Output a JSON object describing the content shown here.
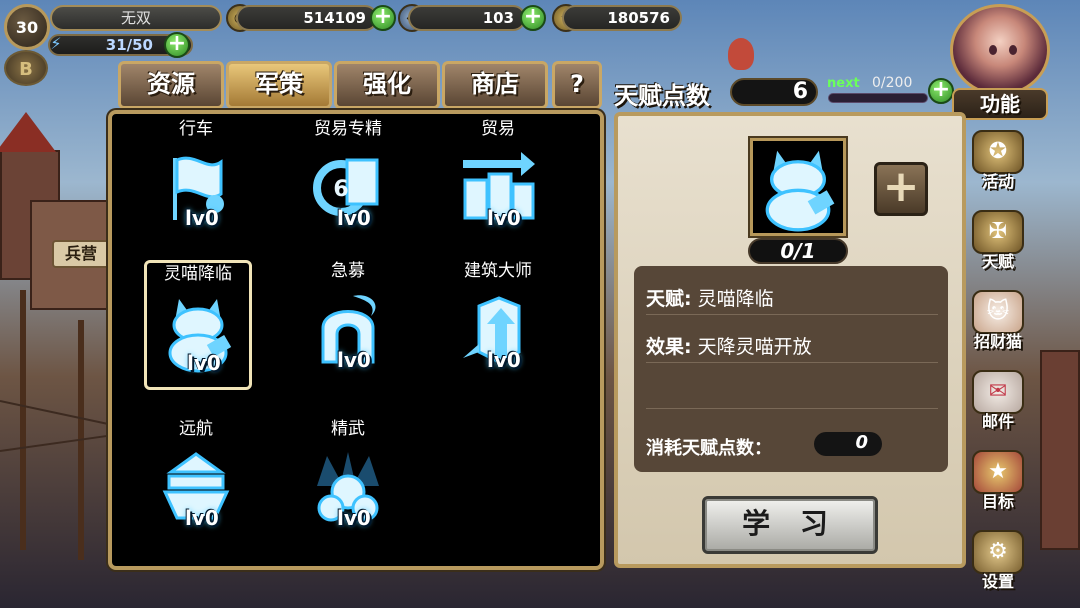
{
  "player": {
    "level": "30",
    "name": "无双",
    "gold": "514109",
    "gems": "103",
    "wheat": "180576",
    "energy": "31/50",
    "coin_letter": "B"
  },
  "tabs": [
    {
      "label": "资源",
      "active": false
    },
    {
      "label": "军策",
      "active": true
    },
    {
      "label": "强化",
      "active": false
    },
    {
      "label": "商店",
      "active": false
    },
    {
      "label": "?",
      "active": false
    }
  ],
  "talent_points": {
    "label": "天赋点数",
    "value": "6",
    "next_label": "next",
    "next_value": "0/200"
  },
  "function_label": "功能",
  "background_sign": "兵营",
  "talents": [
    {
      "name": "行车",
      "level": "lv0",
      "icon": "flag-icon"
    },
    {
      "name": "贸易专精",
      "level": "lv0",
      "icon": "trade-mastery-icon",
      "badge": "6"
    },
    {
      "name": "贸易",
      "level": "lv0",
      "icon": "trade-icon"
    },
    {
      "name": "灵喵降临",
      "level": "lv0",
      "icon": "lucky-cat-icon",
      "selected": true
    },
    {
      "name": "急募",
      "level": "lv0",
      "icon": "helmet-icon"
    },
    {
      "name": "建筑大师",
      "level": "lv0",
      "icon": "building-master-icon"
    },
    {
      "name": "远航",
      "level": "lv0",
      "icon": "ship-icon"
    },
    {
      "name": "精武",
      "level": "lv0",
      "icon": "orbs-icon"
    }
  ],
  "detail": {
    "count": "0/1",
    "talent_key": "天赋:",
    "talent_value": "灵喵降临",
    "effect_key": "效果:",
    "effect_value": "天降灵喵开放",
    "cost_label": "消耗天赋点数：",
    "cost_value": "0",
    "learn_button": "学 习"
  },
  "side_menu": [
    {
      "label": "活动",
      "icon": "activity-icon"
    },
    {
      "label": "天赋",
      "icon": "talent-icon"
    },
    {
      "label": "招财猫",
      "icon": "fortune-cat-icon"
    },
    {
      "label": "邮件",
      "icon": "mail-icon"
    },
    {
      "label": "目标",
      "icon": "goal-icon"
    },
    {
      "label": "设置",
      "icon": "settings-icon"
    }
  ]
}
